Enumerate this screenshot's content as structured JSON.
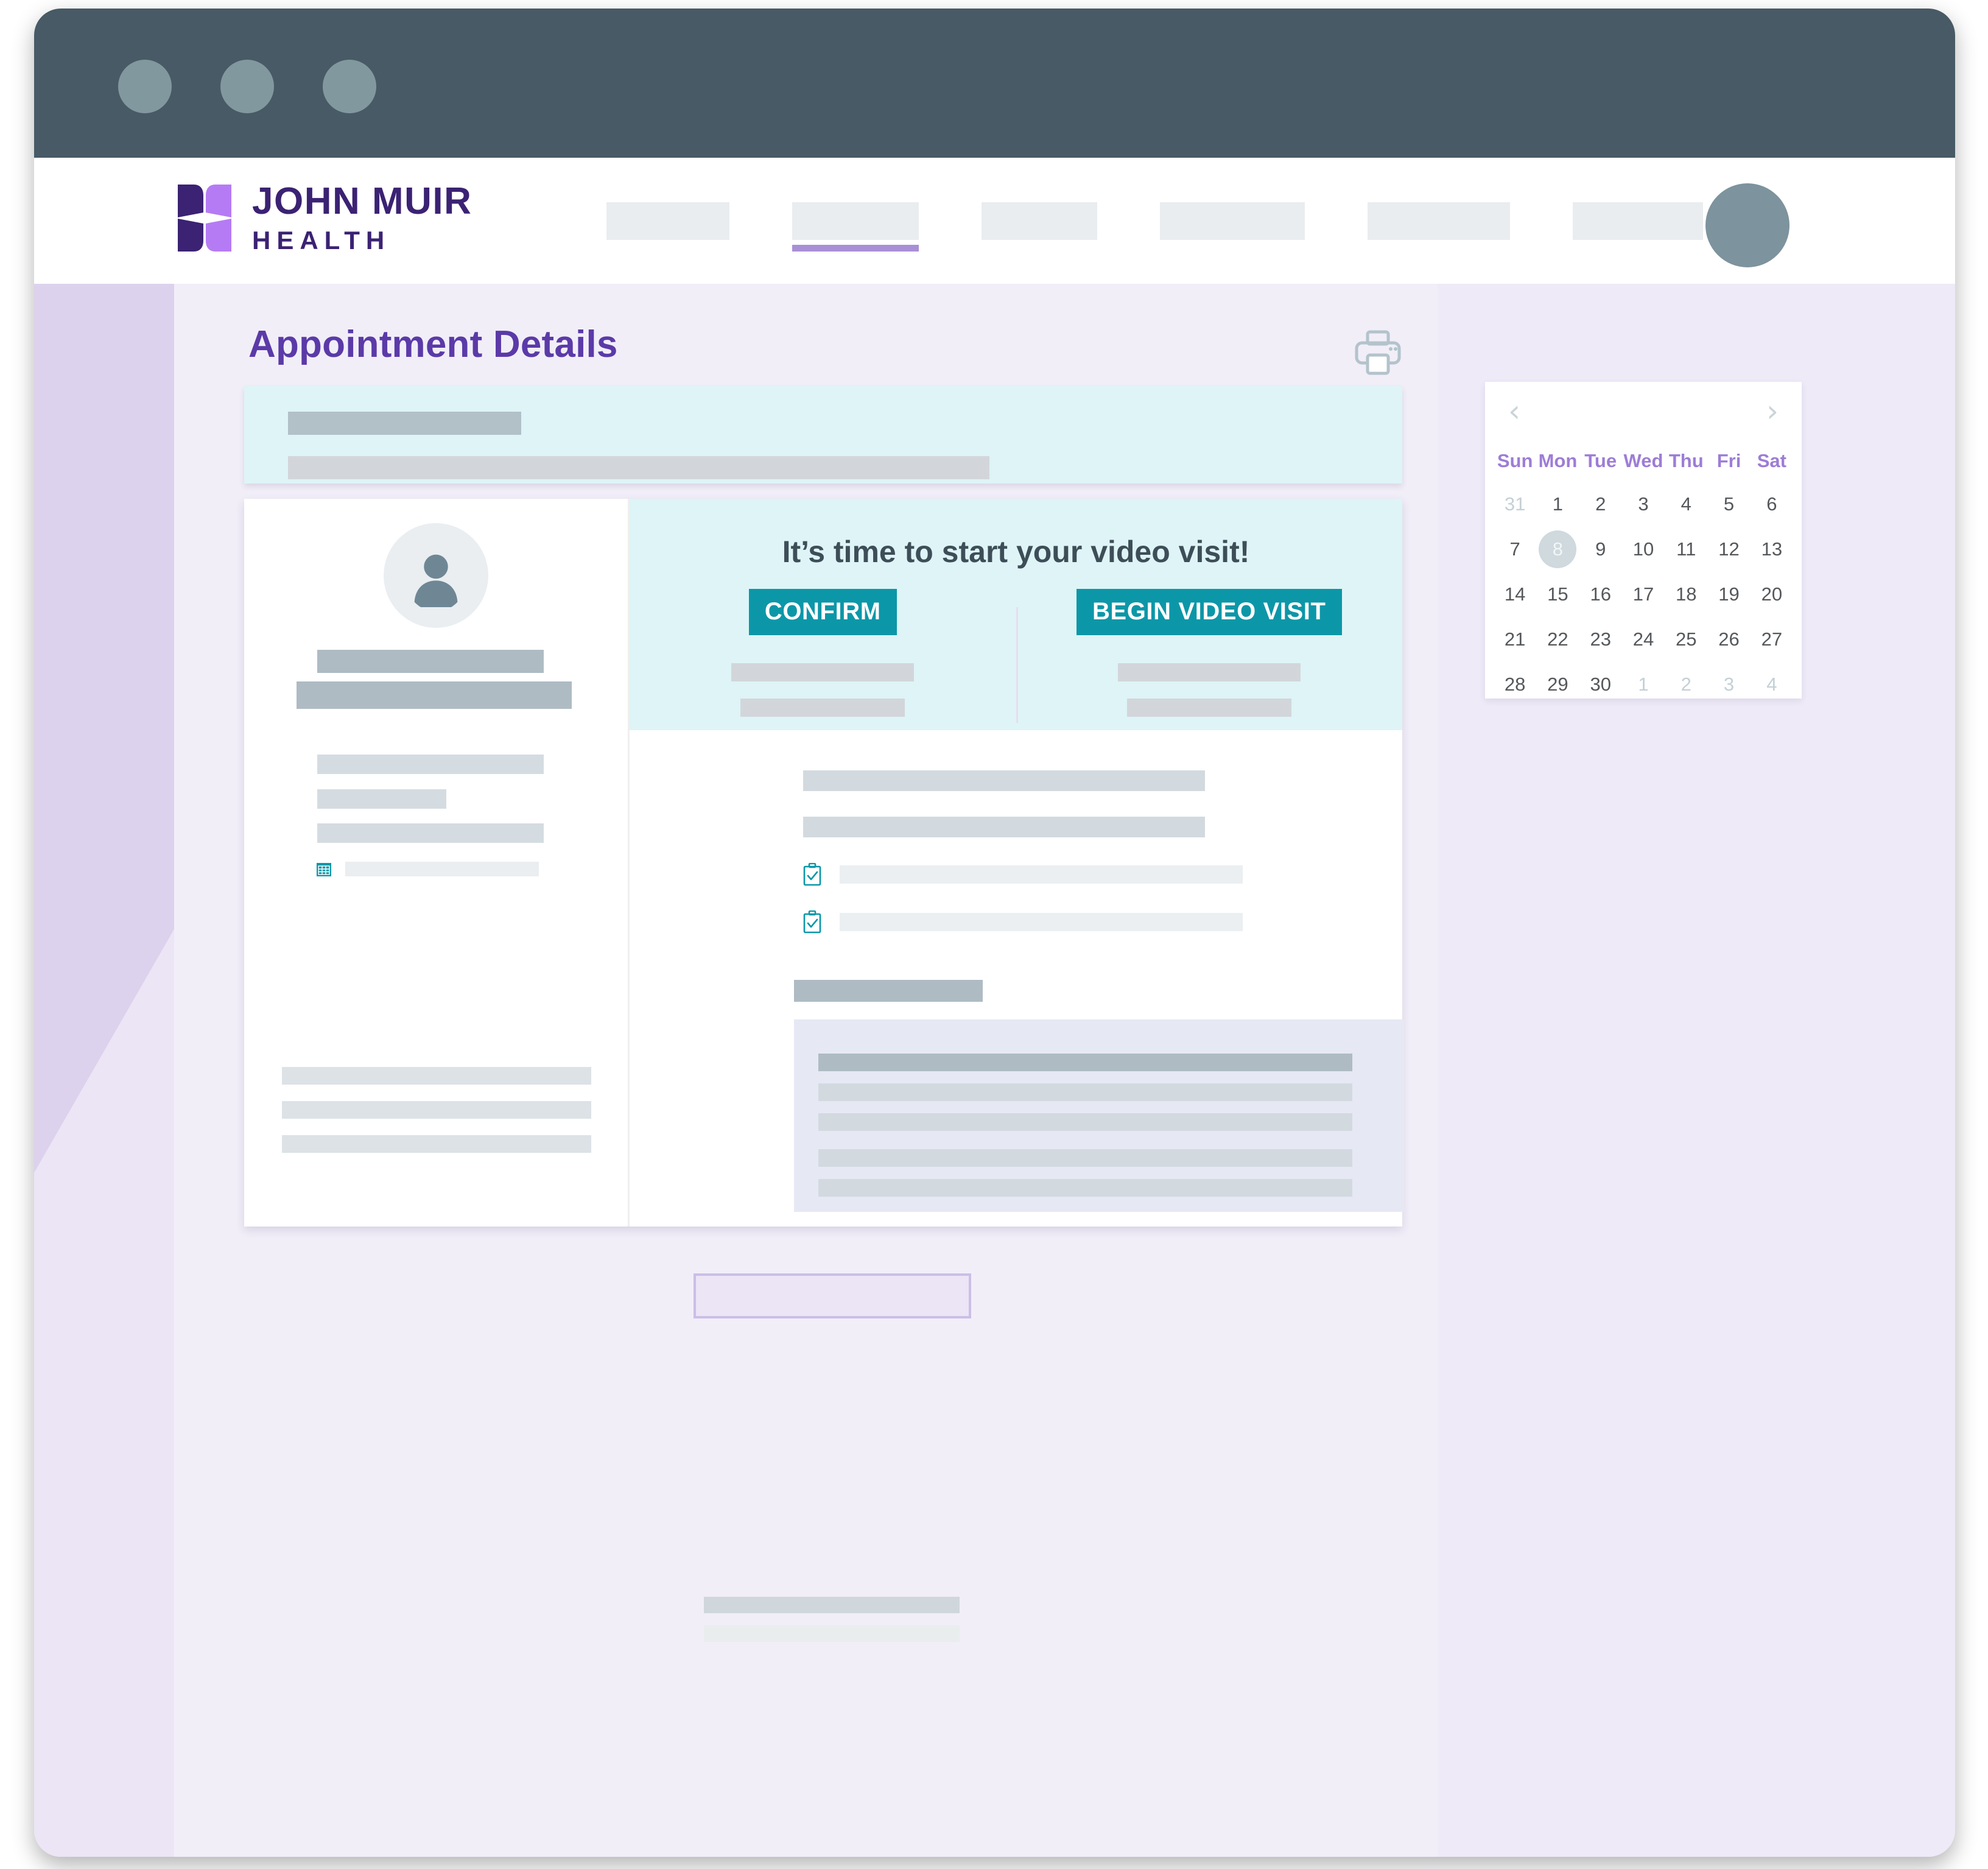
{
  "window": {
    "traffic_lights": [
      "close-dot",
      "minimize-dot",
      "maximize-dot"
    ]
  },
  "header": {
    "logo": {
      "line1": "JOHN MUIR",
      "line2": "HEALTH",
      "mark": "butterfly-logo-mark",
      "dark_purple": "#3B2273",
      "light_purple": "#B57BF5"
    },
    "nav_items": [
      {
        "name": "nav-item-1",
        "label": "",
        "active": false
      },
      {
        "name": "nav-item-2",
        "label": "",
        "active": true
      },
      {
        "name": "nav-item-3",
        "label": "",
        "active": false
      },
      {
        "name": "nav-item-4",
        "label": "",
        "active": false
      },
      {
        "name": "nav-item-5",
        "label": "",
        "active": false
      },
      {
        "name": "nav-item-6",
        "label": "",
        "active": false
      }
    ],
    "avatar": "user-avatar-icon"
  },
  "page": {
    "title": "Appointment Details",
    "title_color": "#5B3AA8",
    "print_icon": "printer-icon"
  },
  "info_banner": {
    "accent": "#DEF4F6",
    "placeholder_lines": 2
  },
  "appointment_card": {
    "provider": {
      "avatar_icon": "person-avatar-icon",
      "calendar_icon": "calendar-icon",
      "placeholder_lines": 6,
      "footer_lines": 3
    },
    "video_visit": {
      "heading": "It’s time to start your video visit!",
      "button_color": "#0C97A8",
      "confirm_label": "CONFIRM",
      "begin_label": "BEGIN VIDEO VISIT",
      "confirm_sub_lines": 2,
      "begin_sub_lines": 2
    },
    "details": {
      "summary_lines": 2,
      "checklist": [
        {
          "icon": "clipboard-check-icon",
          "label": ""
        },
        {
          "icon": "clipboard-check-icon",
          "label": ""
        }
      ],
      "section_heading": "",
      "panel_lines": 5
    }
  },
  "below_card": {
    "lavender_box": "",
    "footer_lines": 2
  },
  "calendar": {
    "prev_label": "‹",
    "next_label": "›",
    "weekday_headers": [
      "Sun",
      "Mon",
      "Tue",
      "Wed",
      "Thu",
      "Fri",
      "Sat"
    ],
    "weekday_color": "#9D7DD6",
    "today": 8,
    "weeks": [
      [
        {
          "d": "31",
          "muted": true,
          "today": false
        },
        {
          "d": "1",
          "muted": false,
          "today": false
        },
        {
          "d": "2",
          "muted": false,
          "today": false
        },
        {
          "d": "3",
          "muted": false,
          "today": false
        },
        {
          "d": "4",
          "muted": false,
          "today": false
        },
        {
          "d": "5",
          "muted": false,
          "today": false
        },
        {
          "d": "6",
          "muted": false,
          "today": false
        }
      ],
      [
        {
          "d": "7",
          "muted": false,
          "today": false
        },
        {
          "d": "8",
          "muted": false,
          "today": true
        },
        {
          "d": "9",
          "muted": false,
          "today": false
        },
        {
          "d": "10",
          "muted": false,
          "today": false
        },
        {
          "d": "11",
          "muted": false,
          "today": false
        },
        {
          "d": "12",
          "muted": false,
          "today": false
        },
        {
          "d": "13",
          "muted": false,
          "today": false
        }
      ],
      [
        {
          "d": "14",
          "muted": false,
          "today": false
        },
        {
          "d": "15",
          "muted": false,
          "today": false
        },
        {
          "d": "16",
          "muted": false,
          "today": false
        },
        {
          "d": "17",
          "muted": false,
          "today": false
        },
        {
          "d": "18",
          "muted": false,
          "today": false
        },
        {
          "d": "19",
          "muted": false,
          "today": false
        },
        {
          "d": "20",
          "muted": false,
          "today": false
        }
      ],
      [
        {
          "d": "21",
          "muted": false,
          "today": false
        },
        {
          "d": "22",
          "muted": false,
          "today": false
        },
        {
          "d": "23",
          "muted": false,
          "today": false
        },
        {
          "d": "24",
          "muted": false,
          "today": false
        },
        {
          "d": "25",
          "muted": false,
          "today": false
        },
        {
          "d": "26",
          "muted": false,
          "today": false
        },
        {
          "d": "27",
          "muted": false,
          "today": false
        }
      ],
      [
        {
          "d": "28",
          "muted": false,
          "today": false
        },
        {
          "d": "29",
          "muted": false,
          "today": false
        },
        {
          "d": "30",
          "muted": false,
          "today": false
        },
        {
          "d": "1",
          "muted": true,
          "today": false
        },
        {
          "d": "2",
          "muted": true,
          "today": false
        },
        {
          "d": "3",
          "muted": true,
          "today": false
        },
        {
          "d": "4",
          "muted": true,
          "today": false
        }
      ]
    ]
  }
}
